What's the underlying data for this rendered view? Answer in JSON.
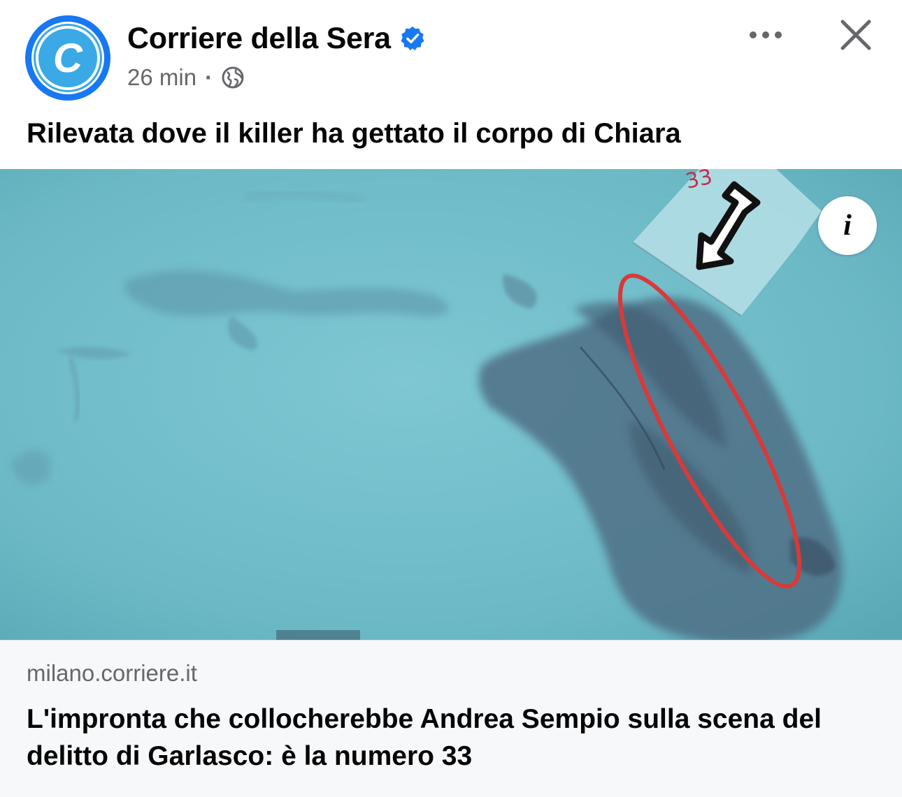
{
  "header": {
    "page_name": "Corriere della Sera",
    "avatar_letter": "C",
    "timestamp": "26 min",
    "separator": "·",
    "audience_icon": "globe-icon",
    "verified_icon": "verified-badge-icon"
  },
  "post": {
    "caption": "Rilevata dove il killer ha gettato il corpo di Chiara"
  },
  "photo": {
    "marker_number": "33",
    "info_label": "i"
  },
  "link_preview": {
    "domain": "milano.corriere.it",
    "title": "L'impronta che collocherebbe Andrea Sempio sulla scena del delitto di Garlasco: è la numero 33"
  },
  "colors": {
    "accent": "#1877f2",
    "avatar_fill": "#3aa9e6",
    "photo_bg": "#6fbcc9",
    "ellipse": "#d83a3a",
    "text_primary": "#050505",
    "text_secondary": "#65676b"
  }
}
